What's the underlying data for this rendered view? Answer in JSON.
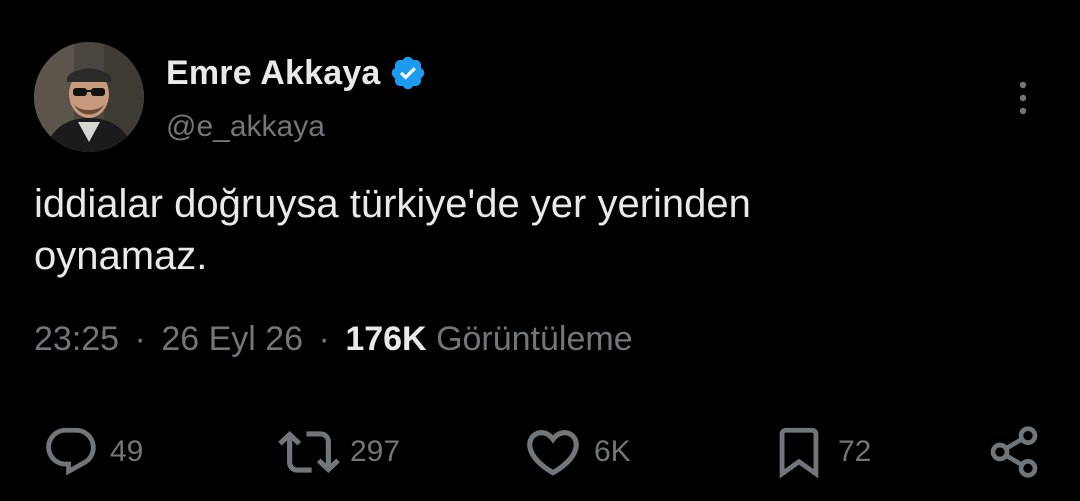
{
  "author": {
    "display_name": "Emre Akkaya",
    "handle": "@e_akkaya",
    "verified": true
  },
  "tweet": {
    "text_line1": "iddialar doğruysa türkiye'de yer yerinden",
    "text_line2": "oynamaz."
  },
  "meta": {
    "time": "23:25",
    "date": "26 Eyl 26",
    "separator": "·",
    "views_count": "176K",
    "views_label": "Görüntüleme"
  },
  "actions": {
    "reply_count": "49",
    "retweet_count": "297",
    "like_count": "6K",
    "bookmark_count": "72"
  },
  "icons": {
    "avatar": "user-avatar-photo",
    "verified": "verified-badge-icon",
    "more": "more-vertical-icon",
    "reply": "reply-icon",
    "retweet": "retweet-icon",
    "like": "heart-icon",
    "bookmark": "bookmark-icon",
    "share": "share-icon"
  },
  "colors": {
    "background": "#000000",
    "primary_text": "#e7e9ea",
    "secondary_text": "#71767b",
    "verified_blue": "#1d9bf0"
  }
}
